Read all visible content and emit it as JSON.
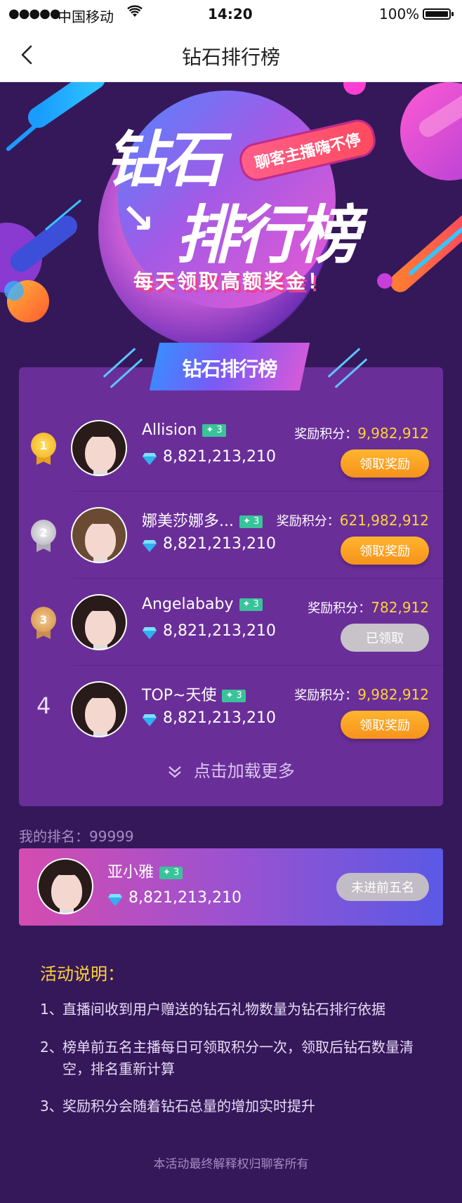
{
  "status_bar": {
    "carrier": "中国移动",
    "time": "14:20",
    "battery": "100%"
  },
  "nav": {
    "title": "钻石排行榜"
  },
  "banner": {
    "title_line1": "钻石",
    "title_line2": "排行榜",
    "tag": "聊客主播嗨不停",
    "subtitle": "每天领取高额奖金！"
  },
  "ranking": {
    "header": "钻石排行榜",
    "reward_label": "奖励积分：",
    "entries": [
      {
        "rank": "1",
        "name": "Allision",
        "level": "✦ 3",
        "diamonds": "8,821,213,210",
        "reward": "9,982,912",
        "button": "领取奖励",
        "claimed": false
      },
      {
        "rank": "2",
        "name": "娜美莎娜多...",
        "level": "✦ 3",
        "diamonds": "8,821,213,210",
        "reward": "621,982,912",
        "button": "领取奖励",
        "claimed": false
      },
      {
        "rank": "3",
        "name": "Angelababy",
        "level": "✦ 3",
        "diamonds": "8,821,213,210",
        "reward": "782,912",
        "button": "已领取",
        "claimed": true
      },
      {
        "rank": "4",
        "name": "TOP~天使",
        "level": "✦ 3",
        "diamonds": "8,821,213,210",
        "reward": "9,982,912",
        "button": "领取奖励",
        "claimed": false
      }
    ],
    "load_more": "点击加载更多"
  },
  "my_rank": {
    "label": "我的排名：99999",
    "name": "亚小雅",
    "level": "✦ 3",
    "diamonds": "8,821,213,210",
    "button": "未进前五名"
  },
  "rules": {
    "title": "活动说明：",
    "items": [
      {
        "num": "1、",
        "text": "直播间收到用户赠送的钻石礼物数量为钻石排行依据"
      },
      {
        "num": "2、",
        "text": "榜单前五名主播每日可领取积分一次，领取后钻石数量清空，排名重新计算"
      },
      {
        "num": "3、",
        "text": "奖励积分会随着钻石总量的增加实时提升"
      }
    ]
  },
  "footer": "本活动最终解释权归聊客所有",
  "colors": {
    "background": "#35185a",
    "card": "#6a2e99",
    "accent_yellow": "#ffd337",
    "button_orange": "#f6921c",
    "level_badge": "#39c39b"
  },
  "icons": {
    "back": "chevron-left-icon",
    "diamond": "diamond-icon",
    "medal": "medal-icon",
    "load_more": "double-chevron-down-icon"
  }
}
